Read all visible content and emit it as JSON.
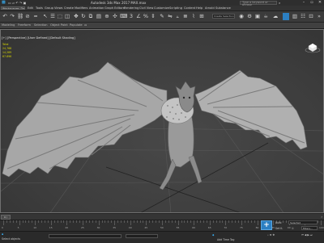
{
  "app": {
    "title": "Autodesk 3ds Max 2017    MAX.max",
    "search_placeholder": "Type a keyword or phrase"
  },
  "menubar": {
    "workspace": "Workspaces: Default",
    "items": [
      "Edit",
      "Tools",
      "Group",
      "Views",
      "Create",
      "Modifiers",
      "Animation",
      "Graph Editors",
      "Rendering",
      "Civil View",
      "Customize",
      "Scripting",
      "Content",
      "Help",
      "Arnold",
      "Substance"
    ]
  },
  "toolbar": {
    "selection_set": "Create Selection Set"
  },
  "ribbon": {
    "tabs": [
      "Modeling",
      "Freeform",
      "Selection",
      "Object Paint",
      "Populate"
    ]
  },
  "viewport": {
    "label": "[+] [Perspective] [User Defined] [Default Shading]",
    "stats": {
      "total": "Total",
      "polys": "24,768",
      "verts": "14,289",
      "fps": "67.896"
    }
  },
  "timeline": {
    "position": "0 / 100",
    "ticks": [
      "0",
      "5",
      "10",
      "15",
      "20",
      "25",
      "30",
      "35",
      "40",
      "45",
      "50",
      "55",
      "60",
      "65",
      "70",
      "75",
      "80",
      "85",
      "90",
      "95",
      "100"
    ]
  },
  "status": {
    "message": "Select objects",
    "add_time_tag": "Add Time Tag",
    "auto_key": "Auto",
    "set_key": "Set K.",
    "selection": "Selected",
    "filters": "Filters..."
  },
  "colors": {
    "accent": "#2c7fc2",
    "stats_text": "#d8d800"
  }
}
